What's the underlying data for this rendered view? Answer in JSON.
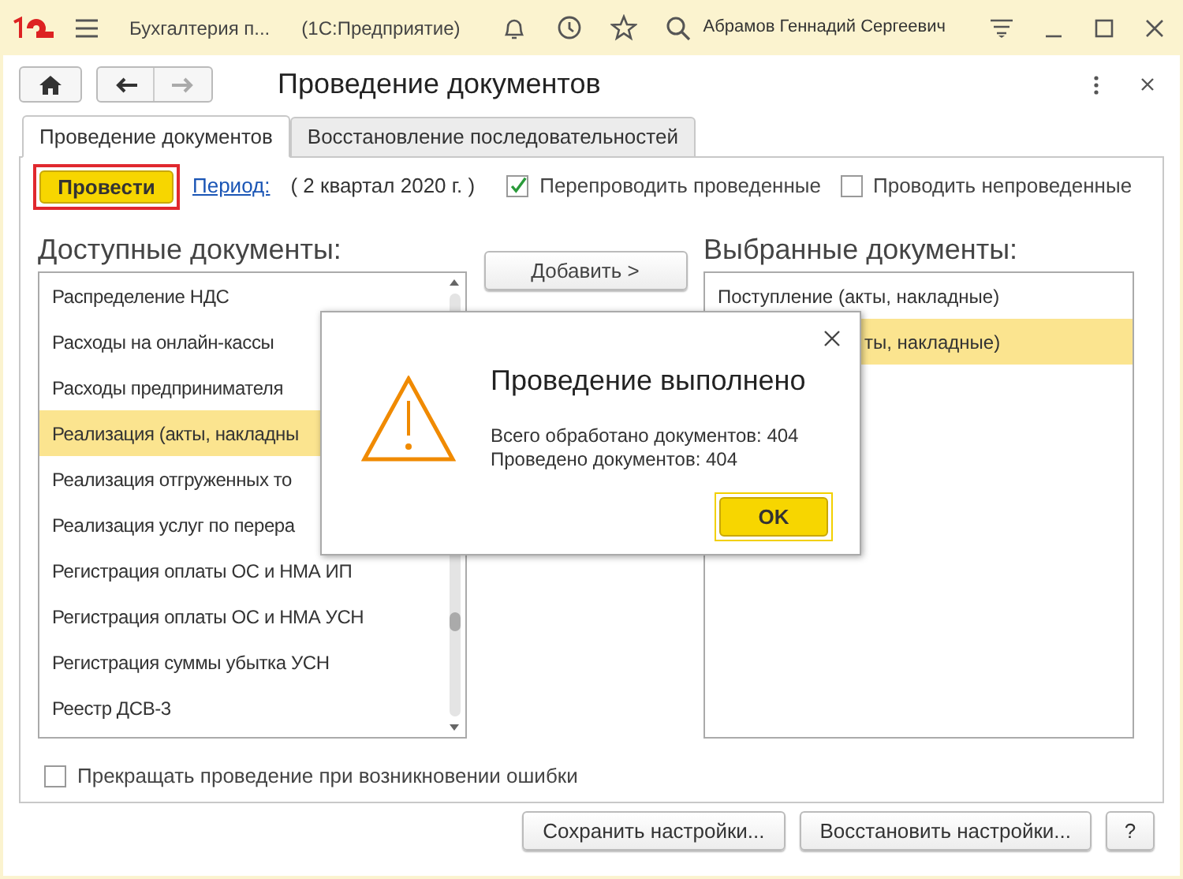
{
  "titlebar": {
    "app": "Бухгалтерия п...",
    "platform": "(1С:Предприятие)",
    "user": "Абрамов Геннадий Сергеевич"
  },
  "form": {
    "title": "Проведение документов"
  },
  "tabs": [
    {
      "label": "Проведение документов",
      "selected": true
    },
    {
      "label": "Восстановление последовательностей",
      "selected": false
    }
  ],
  "toolbar": {
    "run_button": "Провести",
    "period_link": "Период:",
    "period_value": "( 2 квартал 2020 г. )",
    "options": [
      {
        "label": "Перепроводить проведенные",
        "checked": true
      },
      {
        "label": "Проводить непроведенные",
        "checked": false
      }
    ]
  },
  "available": {
    "heading": "Доступные документы:",
    "items": [
      {
        "label": "Распределение НДС",
        "selected": false
      },
      {
        "label": "Расходы на онлайн-кассы",
        "selected": false
      },
      {
        "label": "Расходы предпринимателя",
        "selected": false
      },
      {
        "label": "Реализация (акты, накладны",
        "selected": true
      },
      {
        "label": "Реализация отгруженных то",
        "selected": false
      },
      {
        "label": "Реализация услуг по перера",
        "selected": false
      },
      {
        "label": "Регистрация оплаты ОС и НМА ИП",
        "selected": false
      },
      {
        "label": "Регистрация оплаты ОС и НМА УСН",
        "selected": false
      },
      {
        "label": "Регистрация суммы убытка УСН",
        "selected": false
      },
      {
        "label": "Реестр ДСВ-3",
        "selected": false
      }
    ]
  },
  "add_button": "Добавить >",
  "chosen": {
    "heading": "Выбранные документы:",
    "items": [
      {
        "label": "Поступление (акты, накладные)",
        "selected": false
      },
      {
        "label": "ты, накладные)",
        "selected": true
      }
    ]
  },
  "stop_on_error": {
    "label": "Прекращать проведение при возникновении ошибки",
    "checked": false
  },
  "footer_buttons": [
    "Сохранить настройки...",
    "Восстановить настройки...",
    "?"
  ],
  "dialog": {
    "title": "Проведение выполнено",
    "lines": [
      "Всего обработано документов: 404",
      "Проведено документов: 404"
    ],
    "ok": "OK"
  }
}
